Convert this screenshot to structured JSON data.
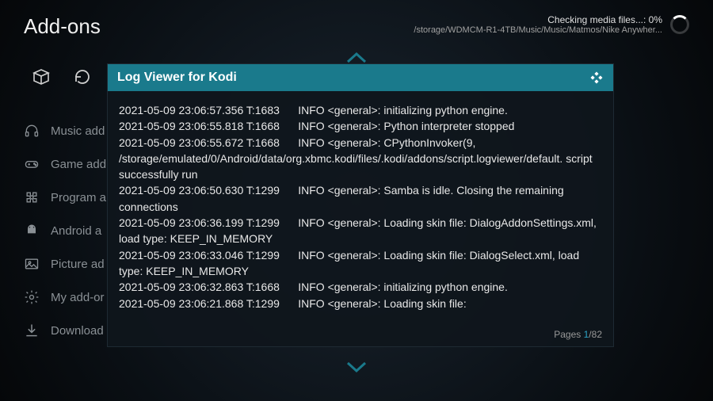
{
  "header": {
    "title": "Add-ons",
    "status_line1": "Checking media files...:  0%",
    "status_line2": "/storage/WDMCM-R1-4TB/Music/Music/Matmos/Nike  Anywher..."
  },
  "sidebar": {
    "items": [
      {
        "label": "Music add"
      },
      {
        "label": "Game add"
      },
      {
        "label": "Program a"
      },
      {
        "label": "Android a"
      },
      {
        "label": "Picture ad"
      },
      {
        "label": "My add-or"
      },
      {
        "label": "Download"
      }
    ]
  },
  "dialog": {
    "title": "Log Viewer for Kodi",
    "pages_label": "Pages ",
    "pages_current": "1",
    "pages_sep": "/",
    "pages_total": "82",
    "log_lines": [
      "2021-05-09 23:06:57.356 T:1683      INFO <general>: initializing python engine.",
      "2021-05-09 23:06:55.818 T:1668      INFO <general>: Python interpreter stopped",
      "2021-05-09 23:06:55.672 T:1668      INFO <general>: CPythonInvoker(9, /storage/emulated/0/Android/data/org.xbmc.kodi/files/.kodi/addons/script.logviewer/default. script successfully run",
      "2021-05-09 23:06:50.630 T:1299      INFO <general>: Samba is idle. Closing the remaining connections",
      "2021-05-09 23:06:36.199 T:1299      INFO <general>: Loading skin file: DialogAddonSettings.xml, load type: KEEP_IN_MEMORY",
      "2021-05-09 23:06:33.046 T:1299      INFO <general>: Loading skin file: DialogSelect.xml, load type: KEEP_IN_MEMORY",
      "2021-05-09 23:06:32.863 T:1668      INFO <general>: initializing python engine.",
      "2021-05-09 23:06:21.868 T:1299      INFO <general>: Loading skin file:"
    ]
  }
}
